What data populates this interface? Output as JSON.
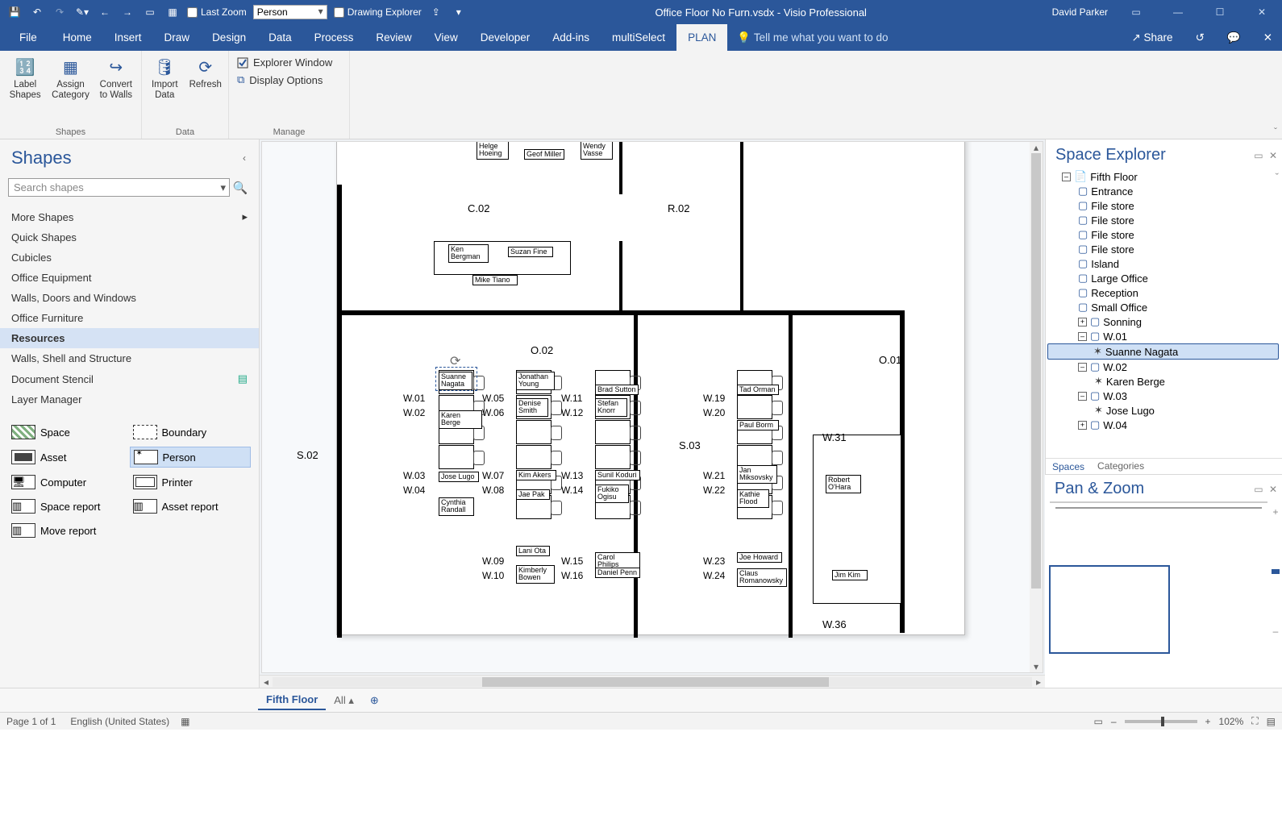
{
  "colors": {
    "brand": "#2b579a",
    "accent_sel": "#cfe0f5"
  },
  "titlebar": {
    "last_zoom": "Last Zoom",
    "person_combo": "Person",
    "drawing_explorer": "Drawing Explorer",
    "doc_title": "Office Floor No Furn.vsdx  -  Visio Professional",
    "user": "David Parker"
  },
  "tabs": {
    "file": "File",
    "home": "Home",
    "insert": "Insert",
    "draw": "Draw",
    "design": "Design",
    "data": "Data",
    "process": "Process",
    "review": "Review",
    "view": "View",
    "developer": "Developer",
    "addins": "Add-ins",
    "multiselect": "multiSelect",
    "plan": "PLAN",
    "tellme": "Tell me what you want to do",
    "share": "Share"
  },
  "ribbon": {
    "label_shapes": "Label Shapes",
    "assign_category": "Assign Category",
    "convert_to_walls": "Convert to Walls",
    "import_data": "Import Data",
    "refresh": "Refresh",
    "explorer_window": "Explorer Window",
    "display_options": "Display Options",
    "grp_shapes": "Shapes",
    "grp_data": "Data",
    "grp_manage": "Manage"
  },
  "shapes_pane": {
    "title": "Shapes",
    "search_ph": "Search shapes",
    "more_shapes": "More Shapes",
    "quick_shapes": "Quick Shapes",
    "stencils": [
      "Cubicles",
      "Office Equipment",
      "Walls, Doors and Windows",
      "Office Furniture"
    ],
    "resources": "Resources",
    "extra": [
      "Walls, Shell and Structure",
      "Document Stencil",
      "Layer Manager"
    ],
    "gallery": {
      "space": "Space",
      "boundary": "Boundary",
      "asset": "Asset",
      "person": "Person",
      "computer": "Computer",
      "printer": "Printer",
      "space_report": "Space report",
      "asset_report": "Asset report",
      "move_report": "Move report"
    }
  },
  "canvas": {
    "rooms": {
      "c02": "C.02",
      "r02": "R.02",
      "o02": "O.02",
      "s02": "S.02",
      "s03": "S.03",
      "o01": "O.01",
      "w31": "W.31",
      "w36": "W.36"
    },
    "wcol1": [
      "W.01",
      "W.02",
      "W.03",
      "W.04"
    ],
    "wcol2": [
      "W.05",
      "W.06",
      "W.07",
      "W.08",
      "W.09",
      "W.10"
    ],
    "wcol3": [
      "W.11",
      "W.12",
      "W.13",
      "W.14",
      "W.15",
      "W.16"
    ],
    "wcol4": [
      "W.19",
      "W.20",
      "W.21",
      "W.22",
      "W.23",
      "W.24"
    ],
    "people_top": {
      "helge": "Helge\nHoeing",
      "geof": "Geof Miller",
      "wendy": "Wendy\nVasse"
    },
    "people_c02": {
      "ken": "Ken\nBergman",
      "suzan": "Suzan Fine",
      "mike": "Mike Tiano"
    },
    "col1": [
      "Suanne\nNagata",
      "Karen Berge",
      "Jose Lugo",
      "Cynthia\nRandall"
    ],
    "col2": [
      "Jonathan\nYoung",
      "Denise\nSmith",
      "Kim Akers",
      "Jae Pak",
      "Lani Ota",
      "Kimberly\nBowen"
    ],
    "col3": [
      "Brad Sutton",
      "Stefan\nKnorr",
      "Sunil Koduri",
      "Fukiko\nOgisu",
      "Carol Philips",
      "Daniel Penn"
    ],
    "col4": [
      "Tad Orman",
      "Paul Borm",
      "Jan\nMiksovsky",
      "Kathie\nFlood",
      "Joe Howard",
      "Claus\nRomanowsky"
    ],
    "office": {
      "robert": "Robert\nO'Hara",
      "jim": "Jim Kim"
    }
  },
  "space_explorer": {
    "title": "Space Explorer",
    "root": "Fifth Floor",
    "children_plain": [
      "Entrance",
      "File store",
      "File store",
      "File store",
      "File store",
      "Island",
      "Large Office",
      "Reception",
      "Small Office"
    ],
    "sonning": "Sonning",
    "w01": "W.01",
    "w01_p": "Suanne Nagata",
    "w02": "W.02",
    "w02_p": "Karen Berge",
    "w03": "W.03",
    "w03_p": "Jose Lugo",
    "w04": "W.04",
    "tab_spaces": "Spaces",
    "tab_categories": "Categories"
  },
  "panzoom": {
    "title": "Pan & Zoom"
  },
  "page_tabs": {
    "active": "Fifth Floor",
    "all": "All"
  },
  "status": {
    "page": "Page 1 of 1",
    "lang": "English (United States)",
    "zoom": "102%"
  }
}
